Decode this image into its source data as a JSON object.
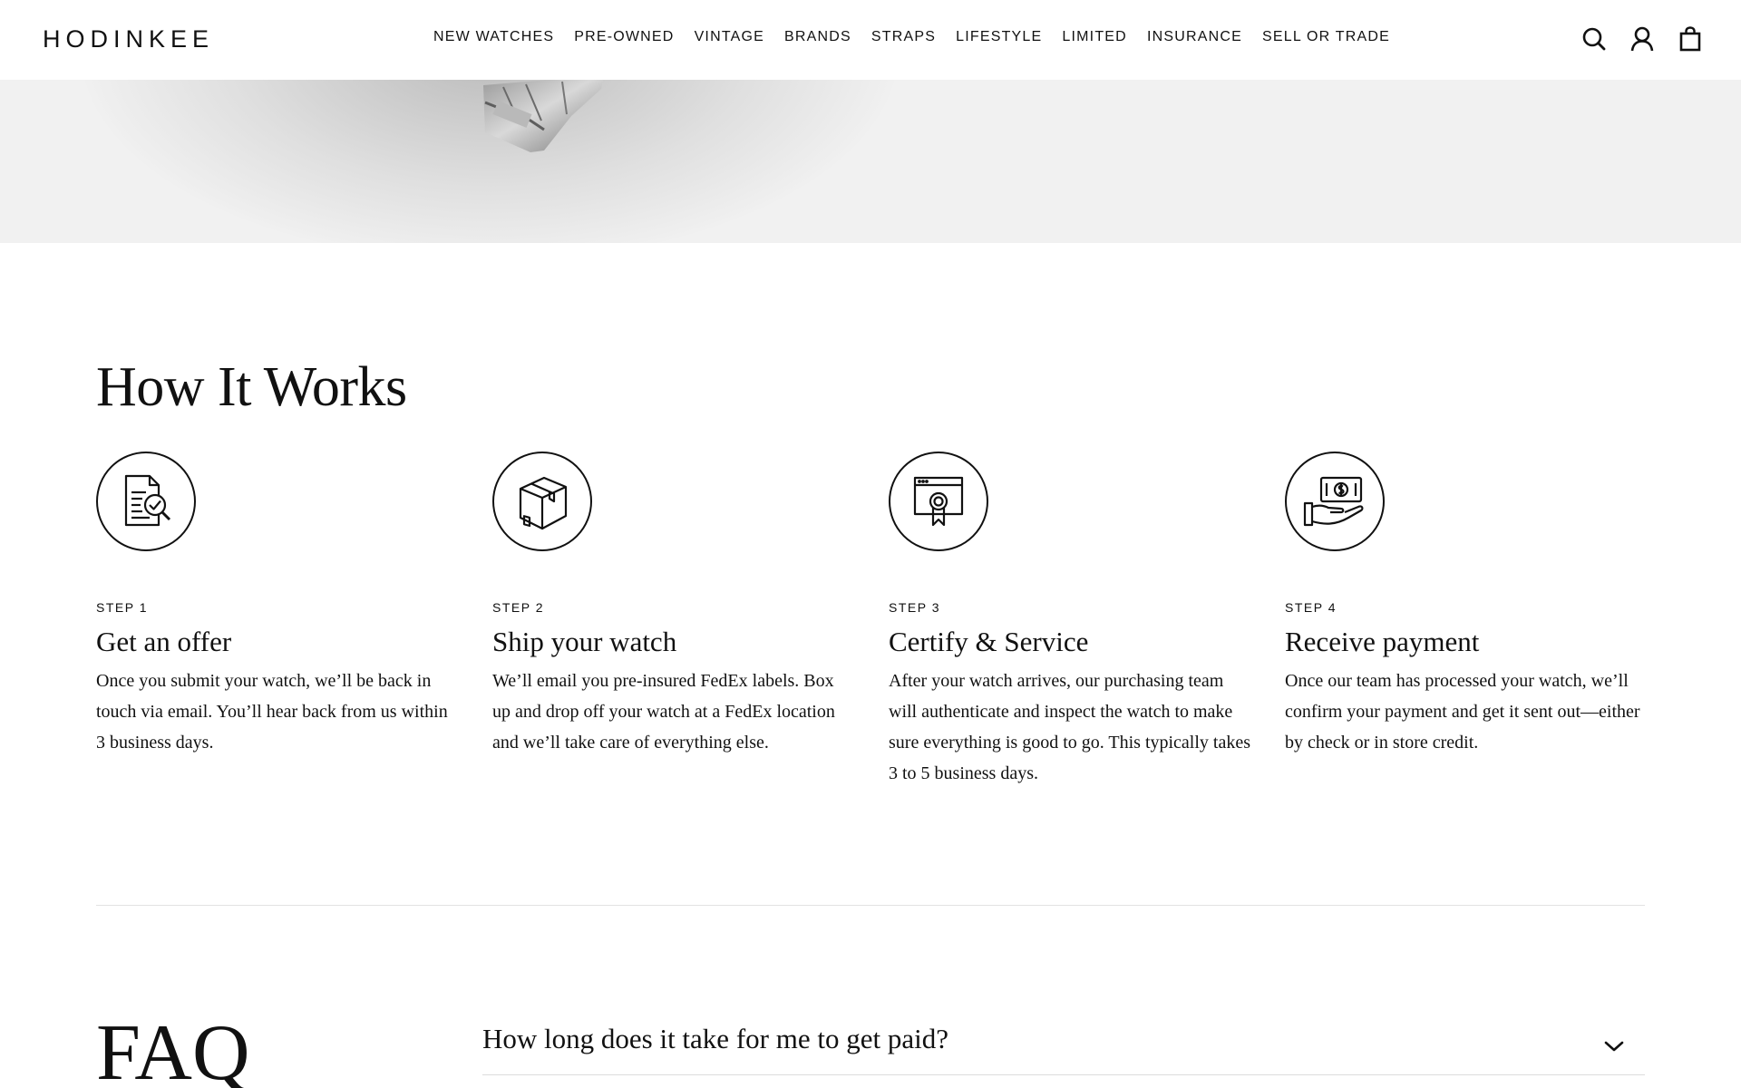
{
  "header": {
    "logo": "HODINKEE",
    "nav": [
      "NEW WATCHES",
      "PRE-OWNED",
      "VINTAGE",
      "BRANDS",
      "STRAPS",
      "LIFESTYLE",
      "LIMITED",
      "INSURANCE",
      "SELL OR TRADE"
    ],
    "icons": [
      "search-icon",
      "account-icon",
      "bag-icon"
    ]
  },
  "how_it_works": {
    "title": "How It Works",
    "steps": [
      {
        "label": "STEP 1",
        "title": "Get an offer",
        "description": "Once you submit your watch, we’ll be back in touch via email. You’ll hear back from us within 3 business days.",
        "icon": "document-check-icon"
      },
      {
        "label": "STEP 2",
        "title": "Ship your watch",
        "description": "We’ll email you pre-insured FedEx labels. Box up and drop off your watch at a FedEx location and we’ll take care of everything else.",
        "icon": "box-icon"
      },
      {
        "label": "STEP 3",
        "title": "Certify & Service",
        "description": "After your watch arrives, our purchasing team will authenticate and inspect the watch to make sure everything is good to go. This typically takes 3 to 5 business days.",
        "icon": "certificate-icon"
      },
      {
        "label": "STEP 4",
        "title": "Receive payment",
        "description": "Once our team has processed your watch, we’ll confirm your payment and get it sent out—either by check or in store credit.",
        "icon": "payment-hand-icon"
      }
    ]
  },
  "faq": {
    "title": "FAQ",
    "items": [
      {
        "question": "How long does it take for me to get paid?",
        "expanded": false
      }
    ]
  }
}
